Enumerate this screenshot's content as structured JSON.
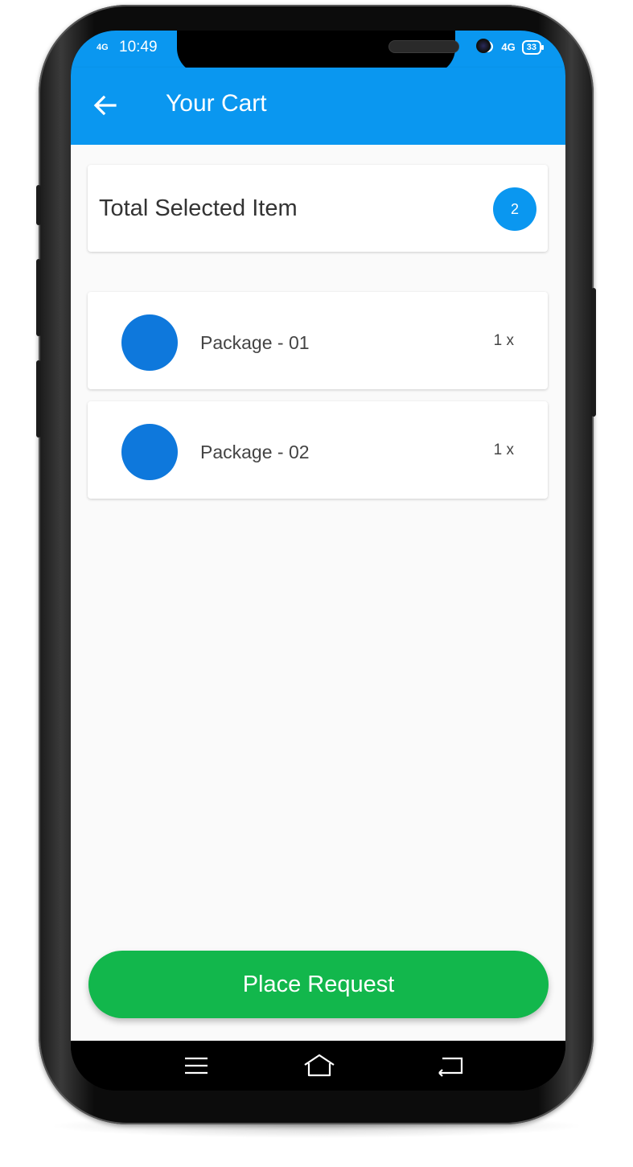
{
  "status_bar": {
    "network": "4G",
    "time": "10:49",
    "right_network": "4G",
    "battery": "33"
  },
  "app_bar": {
    "title": "Your Cart",
    "back_icon": "arrow-left-icon"
  },
  "summary": {
    "label": "Total Selected Item",
    "count": "2"
  },
  "cart_items": [
    {
      "name": "Package - 01",
      "quantity": "1 x"
    },
    {
      "name": "Package - 02",
      "quantity": "1 x"
    }
  ],
  "actions": {
    "place_request_label": "Place Request"
  },
  "nav_bar": {
    "items": [
      "menu-icon",
      "home-icon",
      "back-icon"
    ]
  },
  "colors": {
    "primary": "#0a97f0",
    "item_dot": "#0e78dc",
    "button": "#12b74c"
  }
}
